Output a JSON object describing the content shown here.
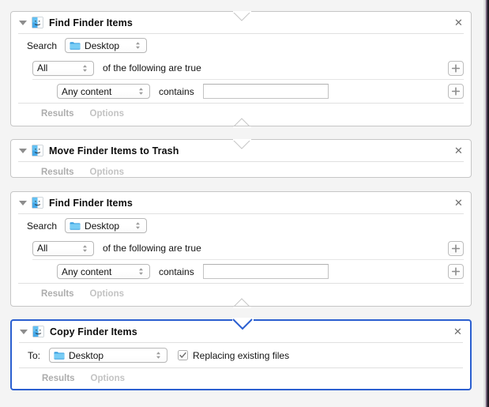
{
  "app": {
    "name": "Automator",
    "view": "workflow-canvas"
  },
  "icons": {
    "finder": "finder-icon",
    "folder": "blue-folder-icon",
    "disclosure": "disclosure-triangle-down-icon",
    "close": "close-x-icon",
    "popup_arrows": "up-down-chevrons-icon",
    "plus": "plus-icon",
    "checkmark": "checkmark-icon"
  },
  "colors": {
    "canvas_background": "#f4f4f4",
    "block_background": "#ffffff",
    "block_border": "#c6c6c6",
    "selection_border": "#2b5fd0",
    "folder_blue": "#59b3ea",
    "footer_link": "#adadad",
    "footer_link_dim": "#c3c3c3"
  },
  "footer": {
    "results_label": "Results",
    "options_label": "Options"
  },
  "actions": [
    {
      "id": "find-finder-items-1",
      "title": "Find Finder Items",
      "selected": false,
      "search": {
        "label": "Search",
        "popup_value": "Desktop"
      },
      "condition": {
        "popup_value": "All",
        "text": "of the following are true"
      },
      "rule": {
        "popup_value": "Any content",
        "operator": "contains",
        "field_value": "",
        "field_placeholder": ""
      }
    },
    {
      "id": "move-finder-items-to-trash",
      "title": "Move Finder Items to Trash",
      "selected": false
    },
    {
      "id": "find-finder-items-2",
      "title": "Find Finder Items",
      "selected": false,
      "search": {
        "label": "Search",
        "popup_value": "Desktop"
      },
      "condition": {
        "popup_value": "All",
        "text": "of the following are true"
      },
      "rule": {
        "popup_value": "Any content",
        "operator": "contains",
        "field_value": "",
        "field_placeholder": ""
      }
    },
    {
      "id": "copy-finder-items",
      "title": "Copy Finder Items",
      "selected": true,
      "destination": {
        "label": "To:",
        "popup_value": "Desktop"
      },
      "replace": {
        "label": "Replacing existing files",
        "checked": true
      }
    }
  ]
}
